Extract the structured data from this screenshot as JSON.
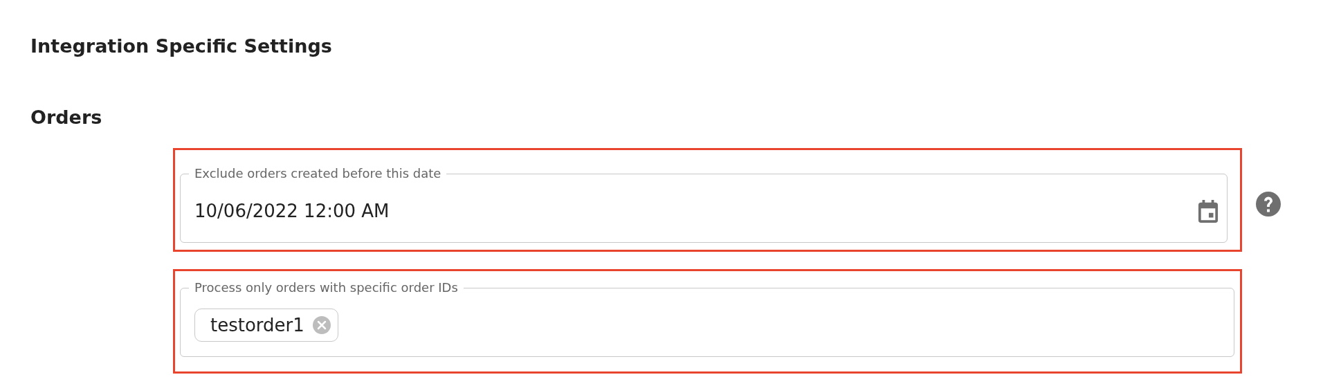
{
  "title": "Integration Specific Settings",
  "section": "Orders",
  "fields": [
    {
      "kind": "date",
      "label": "Exclude orders created before this date",
      "value": "10/06/2022 12:00 AM",
      "highlighted": true,
      "help_icon": true
    },
    {
      "kind": "tags",
      "label": "Process only orders with specific order IDs",
      "tags": [
        "testorder1"
      ],
      "highlighted": true,
      "help_icon": false
    }
  ]
}
